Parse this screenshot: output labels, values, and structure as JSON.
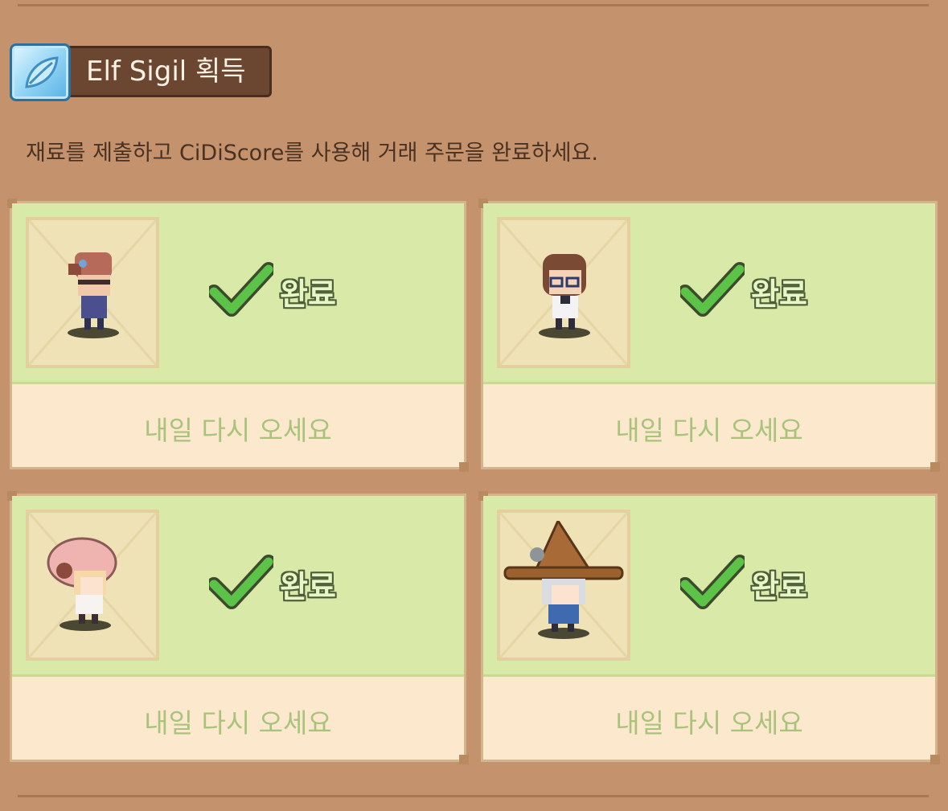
{
  "header": {
    "title": "Elf Sigil 획득",
    "icon": "elf-sigil-icon"
  },
  "description": "재료를 제출하고 CiDiScore를 사용해 거래 주문을 완료하세요.",
  "orders": [
    {
      "status": "완료",
      "action": "내일 다시 오세요",
      "character": "red-hair-bandana-character"
    },
    {
      "status": "완료",
      "action": "내일 다시 오세요",
      "character": "brown-hair-glasses-character"
    },
    {
      "status": "완료",
      "action": "내일 다시 오세요",
      "character": "pink-hood-blonde-character"
    },
    {
      "status": "완료",
      "action": "내일 다시 오세요",
      "character": "witch-hat-grey-hair-character"
    }
  ],
  "colors": {
    "background": "#c4926c",
    "card_top": "#d8e9a8",
    "card_bottom": "#fbe8cd",
    "check": "#58c24a",
    "comeback_text": "#a9c37c"
  }
}
